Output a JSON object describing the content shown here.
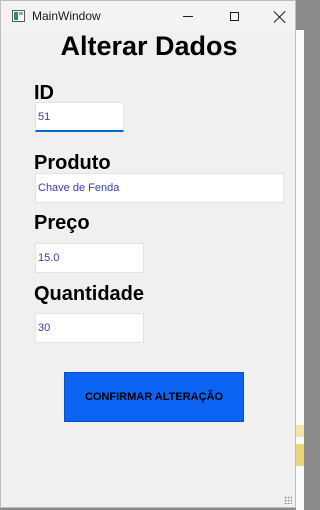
{
  "window": {
    "title": "MainWindow"
  },
  "form": {
    "title": "Alterar Dados",
    "id_label": "ID",
    "id_value": "51",
    "produto_label": "Produto",
    "produto_value": "Chave de Fenda",
    "preco_label": "Preço",
    "preco_value": "15.0",
    "quantidade_label": "Quantidade",
    "quantidade_value": "30",
    "confirm_label": "CONFIRMAR ALTERAÇÃO"
  },
  "colors": {
    "button": "#0a63f3",
    "field_text": "#3a3ab8",
    "focus": "#0066cc"
  },
  "icons": {
    "app": "app-window-icon",
    "minimize": "minimize-icon",
    "maximize": "maximize-icon",
    "close": "close-icon"
  }
}
